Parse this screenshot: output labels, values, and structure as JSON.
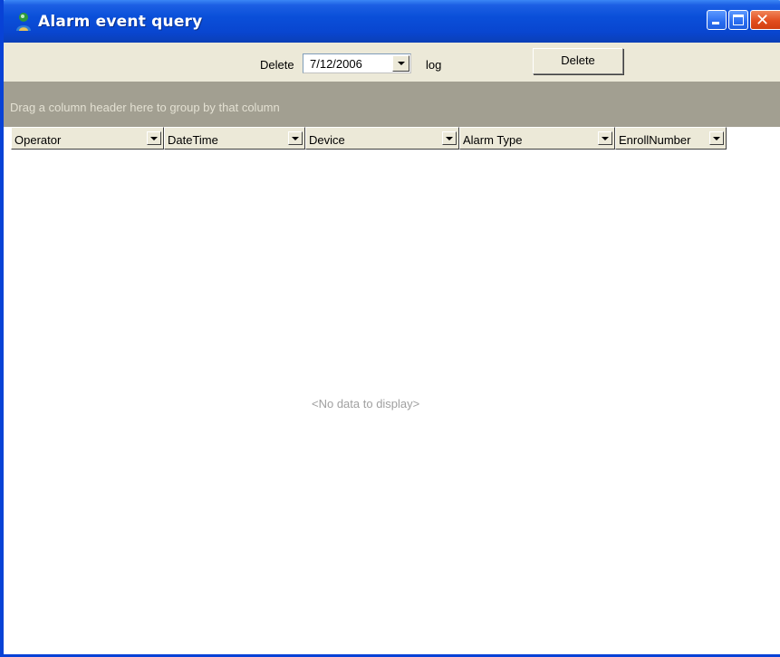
{
  "window": {
    "title": "Alarm event query",
    "icon": "app-person-icon",
    "controls": [
      "minimize-icon",
      "maximize-icon",
      "close-icon"
    ]
  },
  "toolbar": {
    "delete_prefix": "Delete",
    "date_value": "7/12/2006",
    "log_label": "log",
    "delete_button_label": "Delete"
  },
  "grid": {
    "group_panel_hint": "Drag a column header here to group by that column",
    "columns": [
      {
        "label": "Operator"
      },
      {
        "label": "DateTime"
      },
      {
        "label": "Device"
      },
      {
        "label": "Alarm Type"
      },
      {
        "label": "EnrollNumber"
      }
    ],
    "empty_text": "<No data to display>"
  },
  "colors": {
    "titlebar": "#0a4fd9",
    "face": "#ece9d8",
    "group_panel": "#a29f91"
  }
}
